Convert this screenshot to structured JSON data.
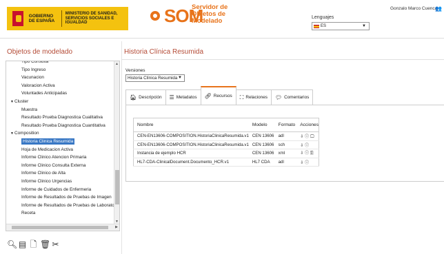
{
  "header": {
    "gov_name": "GOBIERNO DE ESPAÑA",
    "ministry_name": "MINISTERIO DE SANIDAD, SERVICIOS SOCIALES E IGUALDAD",
    "app_logo": "SOM",
    "app_subtitle": "Servidor de Objetos de Modelado",
    "language_label": "Lenguajes",
    "language_value": "ES",
    "user_name": "Gonzalo Marco Cuenca"
  },
  "left": {
    "title": "Objetos de modelado",
    "tree": [
      {
        "label": "Tipo Consulta",
        "level": 1
      },
      {
        "label": "Tipo Ingreso",
        "level": 1
      },
      {
        "label": "Vacunacion",
        "level": 1
      },
      {
        "label": "Valoracion Activa",
        "level": 1
      },
      {
        "label": "Voluntades Anticipadas",
        "level": 1
      },
      {
        "label": "Cluster",
        "level": 0
      },
      {
        "label": "Muestra",
        "level": 1
      },
      {
        "label": "Resultado Prueba Diagnostica Cualitativa",
        "level": 1
      },
      {
        "label": "Resultado Prueba Diagnostica Cuantitativa",
        "level": 1
      },
      {
        "label": "Composition",
        "level": 0
      },
      {
        "label": "Historia Clinica Resumida",
        "level": 1,
        "selected": true
      },
      {
        "label": "Hoja de Medicacion Activa",
        "level": 1
      },
      {
        "label": "Informe Clinico Atencion Primaria",
        "level": 1
      },
      {
        "label": "Informe Clinico Consulta Externa",
        "level": 1
      },
      {
        "label": "Informe Clinico de Alta",
        "level": 1
      },
      {
        "label": "Informe Clinico Urgencias",
        "level": 1
      },
      {
        "label": "Informe de Cuidados de Enfermeria",
        "level": 1
      },
      {
        "label": "Informe de Resultados de Pruebas de Imagen",
        "level": 1
      },
      {
        "label": "Informe de Resultados de Pruebas de Laborato",
        "level": 1
      },
      {
        "label": "Receta",
        "level": 1
      }
    ],
    "toolbar_icons": [
      "search-icon",
      "document-icon",
      "add-document-icon",
      "trash-icon",
      "tools-icon"
    ]
  },
  "main": {
    "title": "Historia Clínica Resumida",
    "versions_label": "Versiones",
    "version_value": "Historia Clínica Resumida",
    "tabs": [
      {
        "label": "Descripción",
        "icon": "home-icon"
      },
      {
        "label": "Metadatos",
        "icon": "list-icon"
      },
      {
        "label": "Recursos",
        "icon": "paperclip-icon",
        "active": true
      },
      {
        "label": "Relaciones",
        "icon": "hierarchy-icon"
      },
      {
        "label": "Comentarios",
        "icon": "comments-icon"
      }
    ],
    "table": {
      "headers": [
        "Nombre",
        "Modelo",
        "Formato",
        "Acciones"
      ],
      "rows": [
        {
          "nombre": "CEN-EN13606-COMPOSITION.HistoriaClinicaResumida.v1",
          "modelo": "CEN 13606",
          "formato": "adl",
          "acciones": "⇩ ⓘ 🖵"
        },
        {
          "nombre": "CEN-EN13606-COMPOSITION.HistoriaClinicaResumida.v1",
          "modelo": "CEN 13606",
          "formato": "sch",
          "acciones": "⇩ ⓘ"
        },
        {
          "nombre": "Instancia de ejemplo HCR",
          "modelo": "CEN 13606",
          "formato": "xml",
          "acciones": "⇩ ⓘ 🖺"
        },
        {
          "nombre": "HL7-CDA-ClinicalDocument.Documento_HCR.v1",
          "modelo": "HL7 CDA",
          "formato": "adl",
          "acciones": "⇩ ⓘ"
        }
      ]
    }
  },
  "colors": {
    "accent": "#e8731a",
    "title_red": "#b44b36",
    "selection": "#3877c4",
    "gov_yellow": "#f4c20f"
  }
}
